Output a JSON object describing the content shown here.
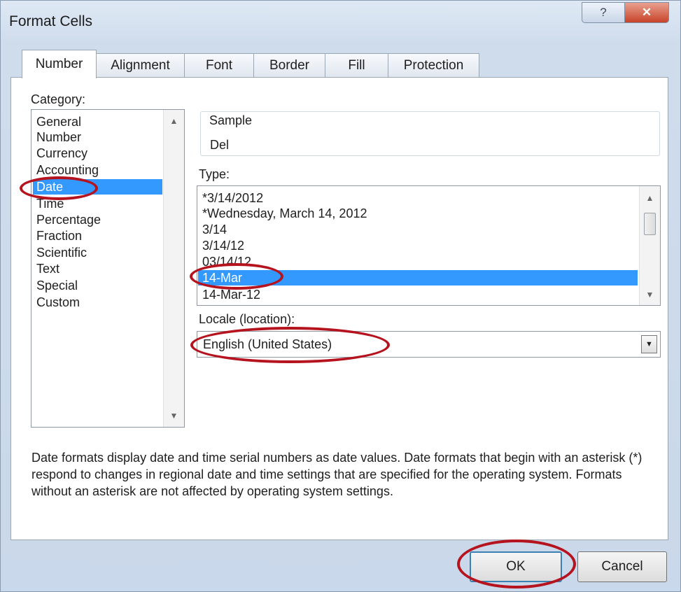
{
  "window": {
    "title": "Format Cells",
    "help_glyph": "?",
    "close_glyph": "✕"
  },
  "tabs": [
    {
      "label": "Number",
      "active": true
    },
    {
      "label": "Alignment",
      "active": false
    },
    {
      "label": "Font",
      "active": false
    },
    {
      "label": "Border",
      "active": false
    },
    {
      "label": "Fill",
      "active": false
    },
    {
      "label": "Protection",
      "active": false
    }
  ],
  "category": {
    "label": "Category:",
    "items": [
      "General",
      "Number",
      "Currency",
      "Accounting",
      "Date",
      "Time",
      "Percentage",
      "Fraction",
      "Scientific",
      "Text",
      "Special",
      "Custom"
    ],
    "selected": "Date"
  },
  "sample": {
    "label": "Sample",
    "value": "Del"
  },
  "type": {
    "label": "Type:",
    "items": [
      "*3/14/2012",
      "*Wednesday, March 14, 2012",
      "3/14",
      "3/14/12",
      "03/14/12",
      "14-Mar",
      "14-Mar-12"
    ],
    "selected": "14-Mar"
  },
  "locale": {
    "label": "Locale (location):",
    "value": "English (United States)"
  },
  "description": "Date formats display date and time serial numbers as date values.  Date formats that begin with an asterisk (*) respond to changes in regional date and time settings that are specified for the operating system. Formats without an asterisk are not affected by operating system settings.",
  "buttons": {
    "ok": "OK",
    "cancel": "Cancel"
  },
  "colors": {
    "selection": "#3399ff",
    "annotation_ring": "#b5131e"
  }
}
